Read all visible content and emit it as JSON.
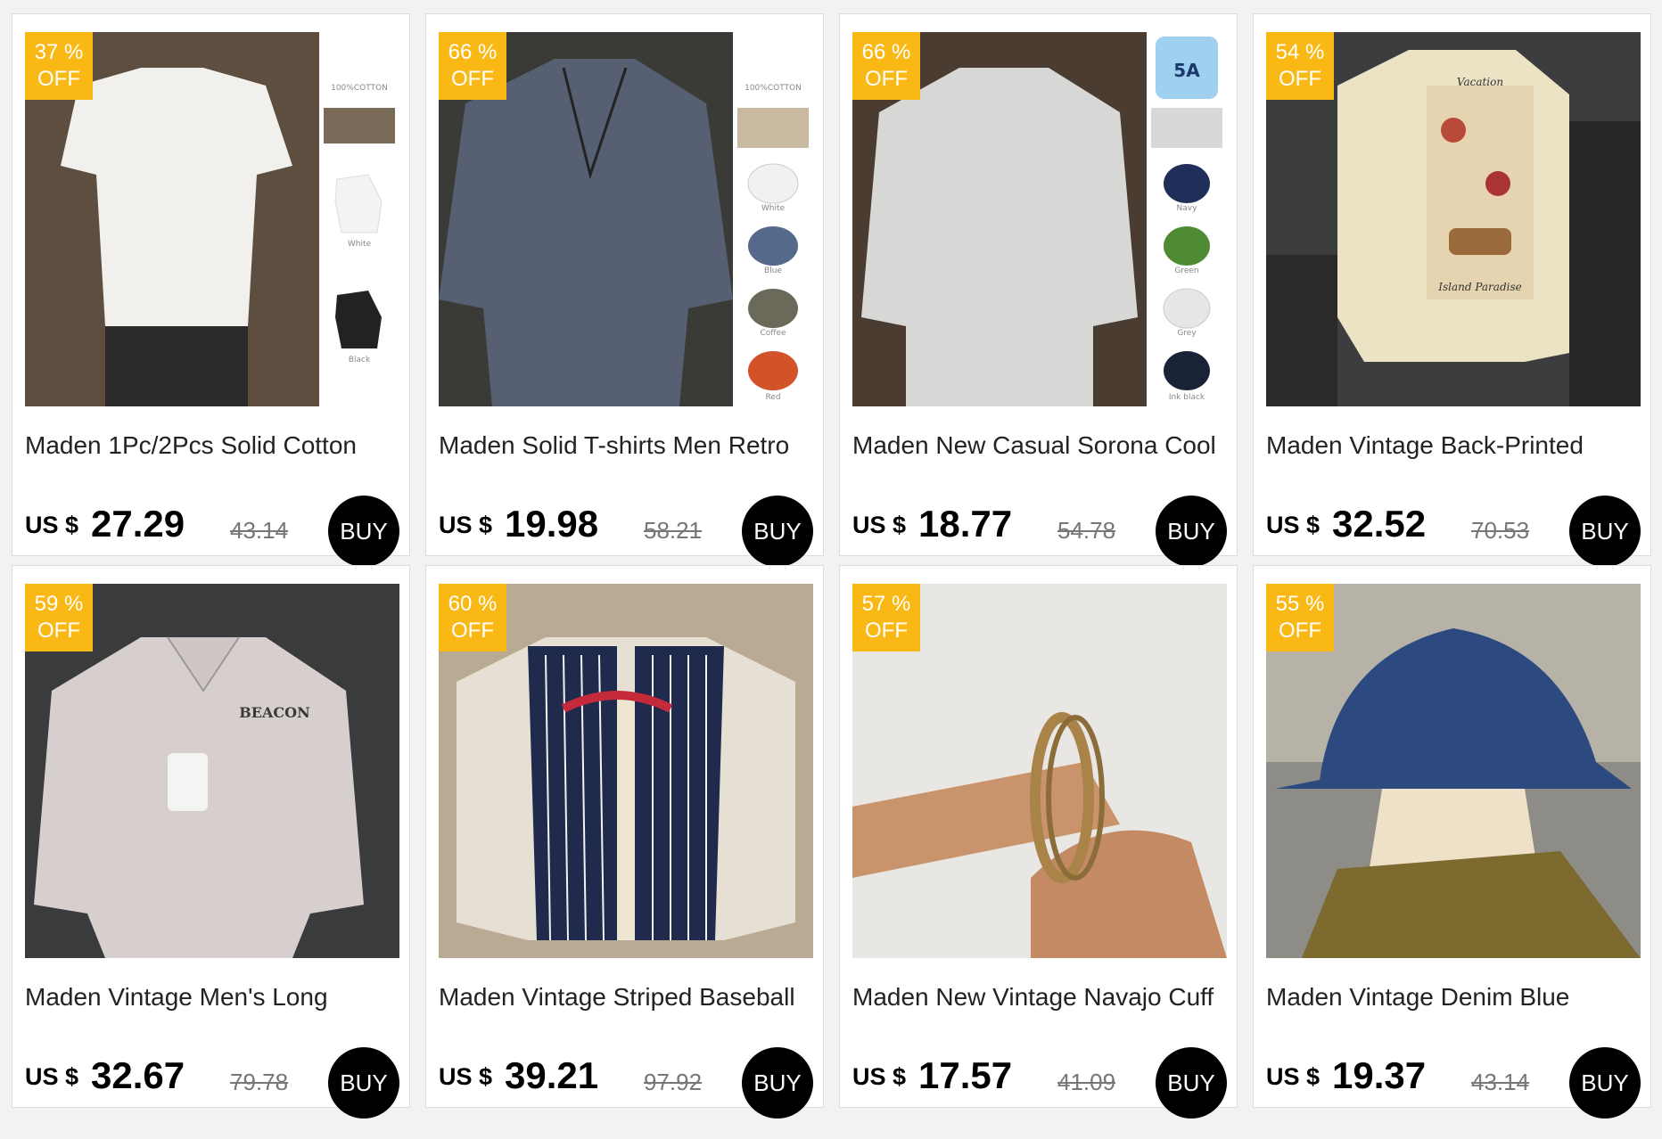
{
  "colors": {
    "badge": "#f9b813",
    "buy_button": "#000000"
  },
  "products": [
    {
      "discount": "37 %",
      "off": "OFF",
      "title": "Maden 1Pc/2Pcs Solid Cotton",
      "currency": "US $",
      "price": "27.29",
      "old_price": "43.14",
      "buy": "BUY",
      "image_labels": [
        "100%COTTON",
        "White",
        "Black"
      ]
    },
    {
      "discount": "66 %",
      "off": "OFF",
      "title": "Maden Solid T-shirts Men Retro",
      "currency": "US $",
      "price": "19.98",
      "old_price": "58.21",
      "buy": "BUY",
      "image_labels": [
        "100%COTTON",
        "White",
        "Blue",
        "Coffee",
        "Red"
      ]
    },
    {
      "discount": "66 %",
      "off": "OFF",
      "title": "Maden New Casual Sorona Cool",
      "currency": "US $",
      "price": "18.77",
      "old_price": "54.78",
      "buy": "BUY",
      "image_labels": [
        "5A",
        "Navy",
        "Green",
        "Grey",
        "Ink black"
      ]
    },
    {
      "discount": "54 %",
      "off": "OFF",
      "title": "Maden Vintage Back-Printed",
      "currency": "US $",
      "price": "32.52",
      "old_price": "70.53",
      "buy": "BUY",
      "image_labels": [
        "Vacation",
        "Island Paradise"
      ]
    },
    {
      "discount": "59 %",
      "off": "OFF",
      "title": "Maden Vintage Men's Long",
      "currency": "US $",
      "price": "32.67",
      "old_price": "79.78",
      "buy": "BUY",
      "image_labels": [
        "BEACON"
      ]
    },
    {
      "discount": "60 %",
      "off": "OFF",
      "title": "Maden Vintage Striped Baseball",
      "currency": "US $",
      "price": "39.21",
      "old_price": "97.92",
      "buy": "BUY",
      "image_labels": []
    },
    {
      "discount": "57 %",
      "off": "OFF",
      "title": "Maden New Vintage Navajo Cuff",
      "currency": "US $",
      "price": "17.57",
      "old_price": "41.09",
      "buy": "BUY",
      "image_labels": []
    },
    {
      "discount": "55 %",
      "off": "OFF",
      "title": "Maden Vintage Denim Blue",
      "currency": "US $",
      "price": "19.37",
      "old_price": "43.14",
      "buy": "BUY",
      "image_labels": []
    }
  ]
}
